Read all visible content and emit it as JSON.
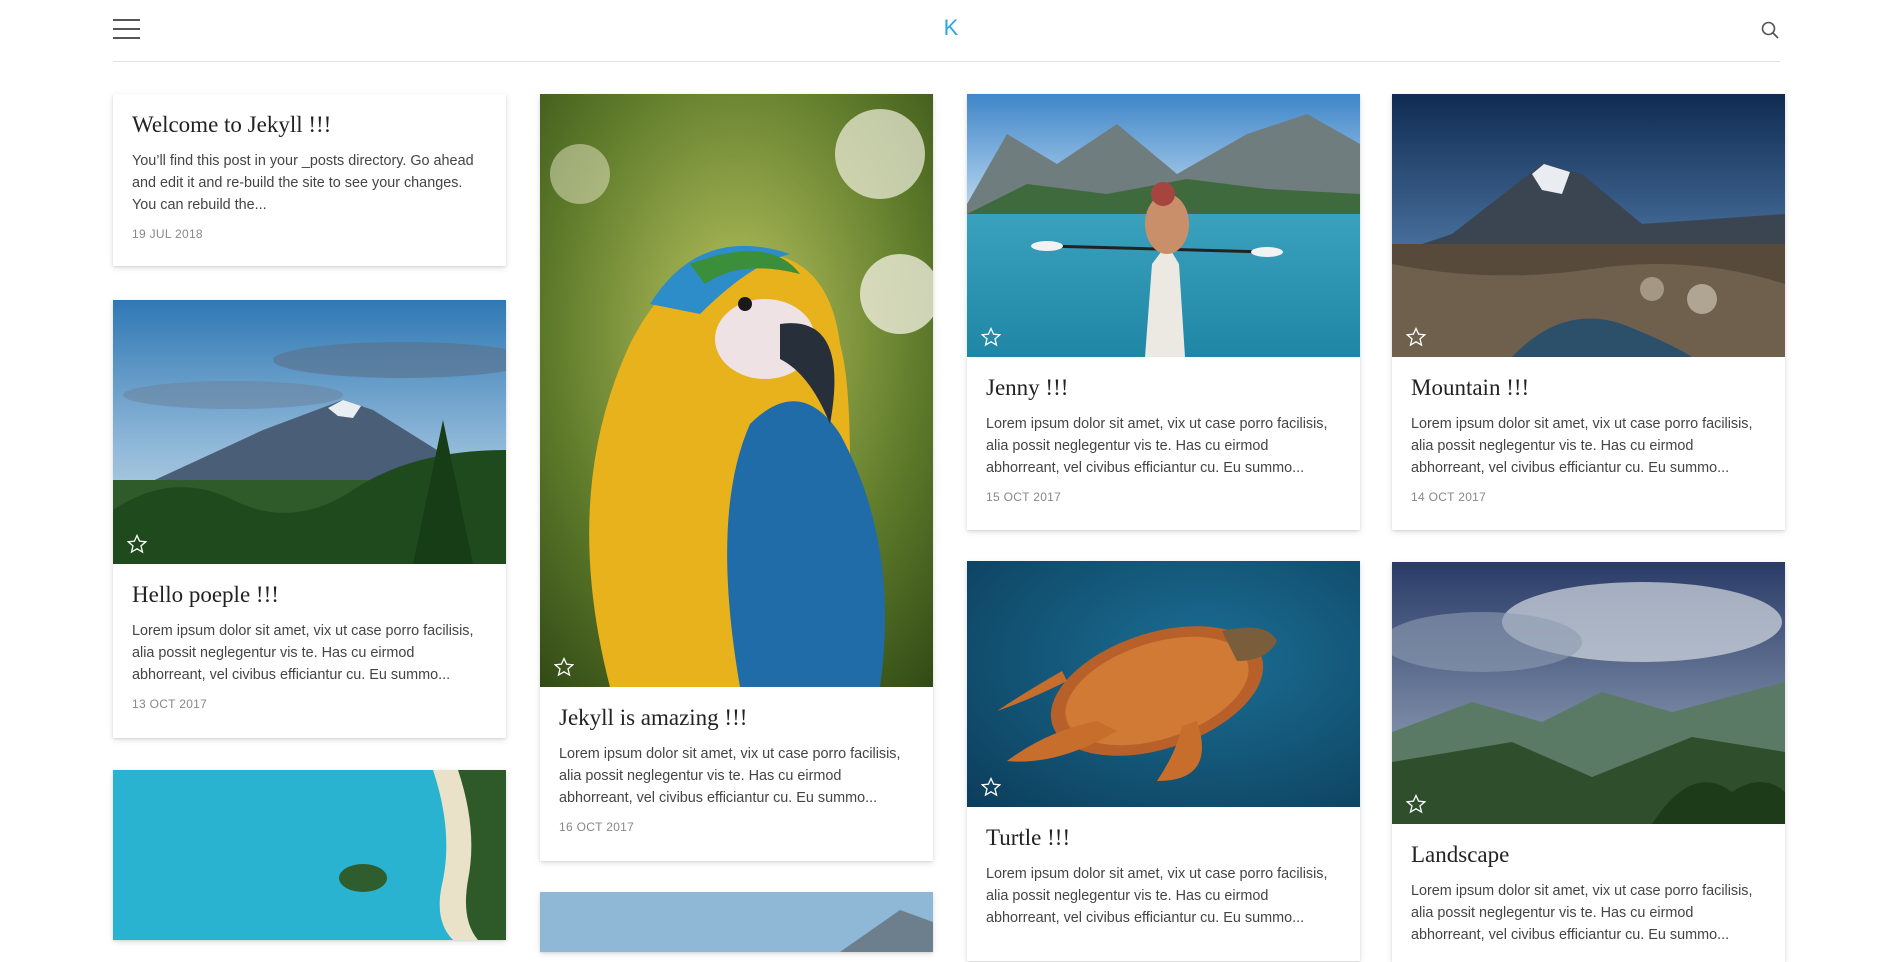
{
  "header": {
    "logo_text": "K",
    "menu_icon": "hamburger-menu-icon",
    "search_icon": "search-icon"
  },
  "posts": [
    {
      "title": "Welcome to Jekyll !!!",
      "excerpt": "You’ll find this post in your _posts directory. Go ahead and edit it and re-build the site to see your changes. You can rebuild the...",
      "date": "19 JUL 2018"
    },
    {
      "title": "Hello poeple !!!",
      "excerpt": "Lorem ipsum dolor sit amet, vix ut case porro facilisis, alia possit neglegentur vis te. Has cu eirmod abhorreant, vel civibus efficiantur cu. Eu summo...",
      "date": "13 OCT 2017"
    },
    {
      "title": "Jekyll is amazing !!!",
      "excerpt": "Lorem ipsum dolor sit amet, vix ut case porro facilisis, alia possit neglegentur vis te. Has cu eirmod abhorreant, vel civibus efficiantur cu. Eu summo...",
      "date": "16 OCT 2017"
    },
    {
      "title": "Jenny !!!",
      "excerpt": "Lorem ipsum dolor sit amet, vix ut case porro facilisis, alia possit neglegentur vis te. Has cu eirmod abhorreant, vel civibus efficiantur cu. Eu summo...",
      "date": "15 OCT 2017"
    },
    {
      "title": "Mountain !!!",
      "excerpt": "Lorem ipsum dolor sit amet, vix ut case porro facilisis, alia possit neglegentur vis te. Has cu eirmod abhorreant, vel civibus efficiantur cu. Eu summo...",
      "date": "14 OCT 2017"
    },
    {
      "title": "Turtle !!!",
      "excerpt": "Lorem ipsum dolor sit amet, vix ut case porro facilisis, alia possit neglegentur vis te. Has cu eirmod abhorreant, vel civibus efficiantur cu. Eu summo..."
    },
    {
      "title": "Landscape",
      "excerpt": "Lorem ipsum dolor sit amet, vix ut case porro facilisis, alia possit neglegentur vis te. Has cu eirmod abhorreant, vel civibus efficiantur cu. Eu summo..."
    }
  ],
  "colors": {
    "accent": "#29a8e0",
    "header_border": "#e2e2e2"
  }
}
